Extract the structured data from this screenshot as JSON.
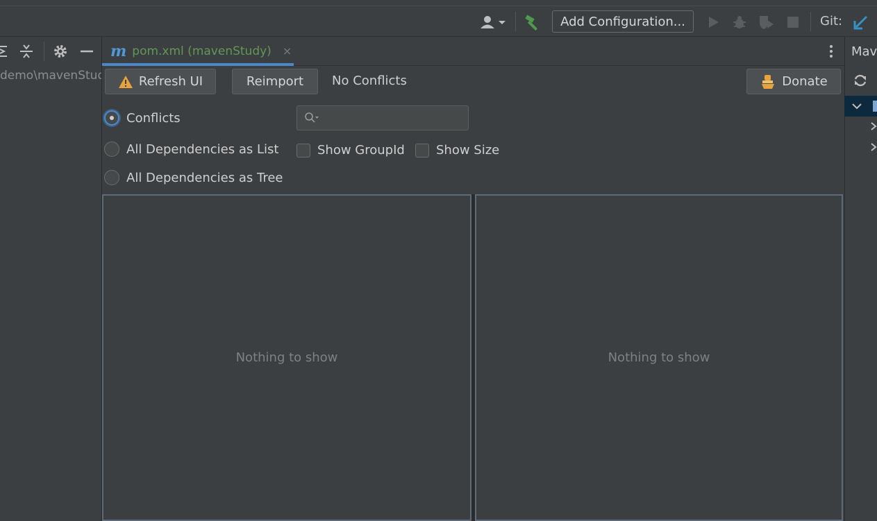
{
  "toolbar": {
    "add_configuration_label": "Add Configuration...",
    "git_label": "Git:"
  },
  "left_panel": {
    "path_text": "demo\\mavenStud"
  },
  "editor": {
    "tab": {
      "icon_letter": "m",
      "label": "pom.xml (mavenStudy)",
      "close_glyph": "×"
    }
  },
  "analyzer": {
    "refresh_label": "Refresh UI",
    "reimport_label": "Reimport",
    "status_text": "No Conflicts",
    "donate_label": "Donate",
    "view_modes": [
      {
        "label": "Conflicts",
        "selected": true
      },
      {
        "label": "All Dependencies as List",
        "selected": false
      },
      {
        "label": "All Dependencies as Tree",
        "selected": false
      }
    ],
    "search": {
      "value": "",
      "placeholder": ""
    },
    "options": [
      {
        "label": "Show GroupId",
        "checked": false
      },
      {
        "label": "Show Size",
        "checked": false
      }
    ],
    "left_pane_empty_text": "Nothing to show",
    "right_pane_empty_text": "Nothing to show"
  },
  "maven_panel": {
    "title": "Mav"
  },
  "colors": {
    "background": "#3c3f41",
    "accent": "#4a88c7",
    "tab_text": "#629755",
    "warning": "#e8a33d",
    "build_hammer": "#4e9a4e"
  }
}
